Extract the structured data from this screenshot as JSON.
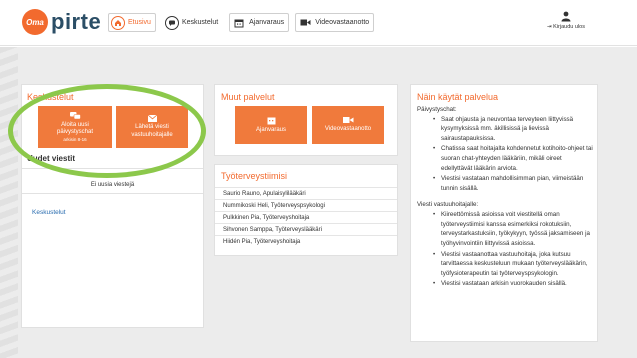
{
  "header": {
    "logo_badge": "Oma",
    "logo_word": "pirte",
    "nav": [
      {
        "label": "Etusivu",
        "icon": "home-icon",
        "active": true
      },
      {
        "label": "Keskustelut",
        "icon": "chat-icon"
      },
      {
        "label": "Ajanvaraus",
        "icon": "calendar-icon"
      },
      {
        "label": "Videovastaanotto",
        "icon": "video-camera-icon"
      }
    ],
    "logout_label": "Kirjaudu ulos"
  },
  "keskustelut": {
    "title": "Keskustelut",
    "tile1_line1": "Aloita uusi",
    "tile1_line2": "päivystyschat",
    "tile1_small": "arkisin 8-16",
    "tile2_line1": "Lähetä viesti",
    "tile2_line2": "vastuuhoitajalle",
    "new_messages_heading": "Uudet viestit",
    "no_messages": "Ei uusia viestejä",
    "link": "Keskustelut"
  },
  "muut": {
    "title": "Muut palvelut",
    "tile1": "Ajanvaraus",
    "tile2": "Videovastaanotto"
  },
  "tiimi": {
    "title": "Työterveystiimisi",
    "members": [
      "Saurio Rauno, Apulaisylilääkäri",
      "Nummikoski Heli, Työterveyspsykologi",
      "Pulkkinen Pia, Työterveyshoitaja",
      "Sihvonen Samppa, Työterveyslääkäri",
      "Hiidén Pia, Työterveyshoitaja"
    ]
  },
  "help": {
    "title": "Näin käytät palvelua",
    "section1": "Päivystyschat:",
    "bullets1": [
      "Saat ohjausta ja neuvontaa terveyteen liittyvissä kysymyksissä mm. äkillisissä ja lievissä sairaustapauksissa.",
      "Chatissa saat hoitajalta kohdennetut kotihoito-ohjeet tai suoran chat-yhteyden lääkäriin, mikäli oireet edellyttävät lääkärin arviota.",
      "Viestisi vastataan mahdollisimman pian, viimeistään tunnin sisällä."
    ],
    "section2": "Viesti vastuuhoitajalle:",
    "bullets2": [
      "Kiireettömissä asioissa voit viestitellä oman työterveystiimisi kanssa esimerkiksi rokotuksiin, terveystarkastuksiin, työkykyyn, työssä jaksamiseen ja työhyvinvointiin liittyvissä asioissa.",
      "Viestisi vastaanottaa vastuuhoitaja, joka kutsuu tarvittaessa keskusteluun mukaan työterveyslääkärin, työfysioterapeutin tai työterveyspsykologin.",
      "Viestisi vastataan arkisin vuorokauden sisällä."
    ]
  },
  "colors": {
    "accent": "#f26a2e",
    "highlight": "#8cc84b",
    "brand": "#2b4e66"
  }
}
